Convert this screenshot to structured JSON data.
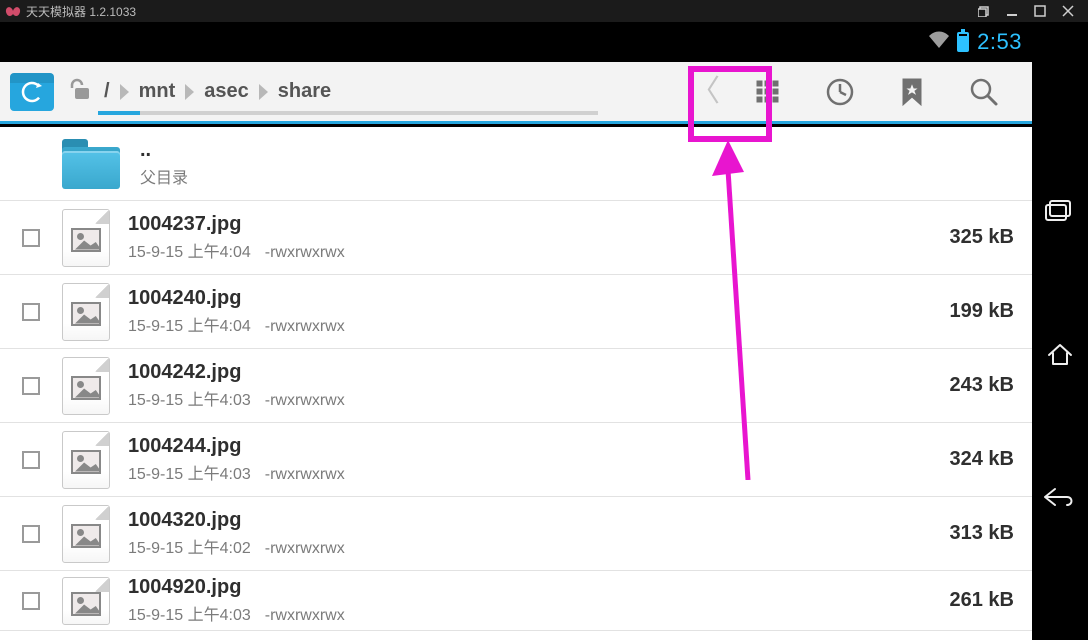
{
  "emulator": {
    "title": "天天模拟器 1.2.1033"
  },
  "status": {
    "time": "2:53"
  },
  "breadcrumb": {
    "root": "/",
    "segments": [
      "mnt",
      "asec",
      "share"
    ]
  },
  "parent": {
    "name": "..",
    "label": "父目录"
  },
  "files": [
    {
      "name": "1004237.jpg",
      "date": "15-9-15 上午4:04",
      "perm": "-rwxrwxrwx",
      "size": "325 kB"
    },
    {
      "name": "1004240.jpg",
      "date": "15-9-15 上午4:04",
      "perm": "-rwxrwxrwx",
      "size": "199 kB"
    },
    {
      "name": "1004242.jpg",
      "date": "15-9-15 上午4:03",
      "perm": "-rwxrwxrwx",
      "size": "243 kB"
    },
    {
      "name": "1004244.jpg",
      "date": "15-9-15 上午4:03",
      "perm": "-rwxrwxrwx",
      "size": "324 kB"
    },
    {
      "name": "1004320.jpg",
      "date": "15-9-15 上午4:02",
      "perm": "-rwxrwxrwx",
      "size": "313 kB"
    },
    {
      "name": "1004920.jpg",
      "date": "15-9-15 上午4:03",
      "perm": "-rwxrwxrwx",
      "size": "261 kB"
    }
  ]
}
